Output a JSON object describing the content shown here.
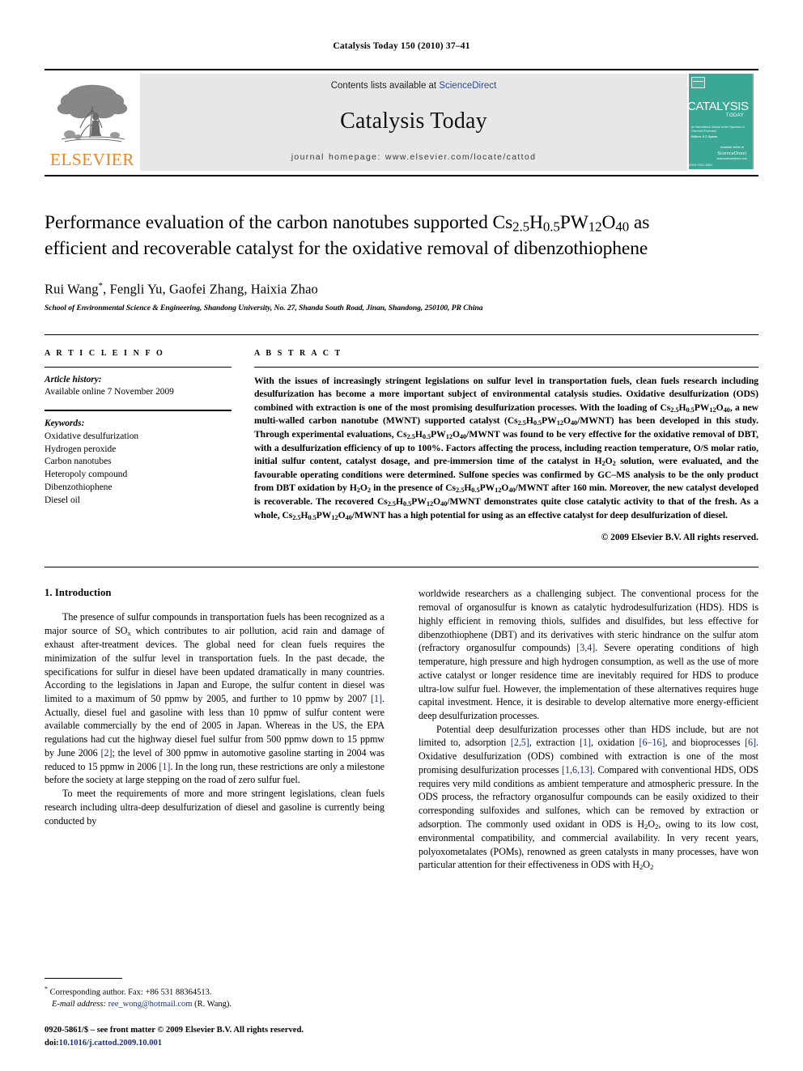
{
  "running_head": "Catalysis Today 150 (2010) 37–41",
  "masthead": {
    "publisher_name": "ELSEVIER",
    "contents_prefix": "Contents lists available at ",
    "contents_link": "ScienceDirect",
    "journal_name": "Catalysis Today",
    "homepage": "journal homepage: www.elsevier.com/locate/cattod",
    "cover": {
      "title": "CATALYSIS",
      "year": "TODAY",
      "subtitle": "An International Journal on the Dynamics of Chemical Processes",
      "editors": "Editors:\nS.T. Oyama",
      "sd_label": "Available online at",
      "sd_name": "ScienceDirect",
      "sd_url": "www.sciencedirect.com",
      "footer": "ISSN 0920-5861"
    }
  },
  "article": {
    "title_line1": "Performance evaluation of the carbon nanotubes supported Cs",
    "title_sub1": "2.5",
    "title_mid1": "H",
    "title_sub2": "0.5",
    "title_mid2": "PW",
    "title_sub3": "12",
    "title_mid3": "O",
    "title_sub4": "40",
    "title_tail1": " as",
    "title_line2": "efficient and recoverable catalyst for the oxidative removal of dibenzothiophene",
    "authors": "Rui Wang",
    "authors_rest": ", Fengli Yu, Gaofei Zhang, Haixia Zhao",
    "corresponding_marker": "*",
    "affiliation": "School of Environmental Science & Engineering, Shandong University, No. 27, Shanda South Road, Jinan, Shandong, 250100, PR China"
  },
  "article_info": {
    "heading": "A R T I C L E   I N F O",
    "history_label": "Article history:",
    "history_value": "Available online 7 November 2009",
    "keywords_label": "Keywords:",
    "keywords": [
      "Oxidative desulfurization",
      "Hydrogen peroxide",
      "Carbon nanotubes",
      "Heteropoly compound",
      "Dibenzothiophene",
      "Diesel oil"
    ]
  },
  "abstract": {
    "heading": "A B S T R A C T",
    "text_part1": "With the issues of increasingly stringent legislations on sulfur level in transportation fuels, clean fuels research including desulfurization has become a more important subject of environmental catalysis studies. Oxidative desulfurization (ODS) combined with extraction is one of the most promising desulfurization processes. With the loading of ",
    "text_part2": ", a new multi-walled carbon nanotube (MWNT) supported catalyst (",
    "text_part3": "/MWNT) has been developed in this study. Through experimental evaluations, ",
    "text_part4": "/MWNT was found to be very effective for the oxidative removal of DBT, with a desulfurization efficiency of up to 100%. Factors affecting the process, including reaction temperature, O/S molar ratio, initial sulfur content, catalyst dosage, and pre-immersion time of the catalyst in H",
    "text_part5": " solution, were evaluated, and the favourable operating conditions were determined. Sulfone species was confirmed by GC–MS analysis to be the only product from DBT oxidation by H",
    "text_part6": " in the presence of ",
    "text_part7": "/MWNT after 160 min. Moreover, the new catalyst developed is recoverable. The recovered ",
    "text_part8": "/MWNT demonstrates quite close catalytic activity to that of the fresh. As a whole, ",
    "text_part9": "/MWNT has a high potential for using as an effective catalyst for deep desulfurization of diesel.",
    "copyright": "© 2009 Elsevier B.V. All rights reserved."
  },
  "introduction": {
    "heading": "1. Introduction",
    "left_p1_a": "The presence of sulfur compounds in transportation fuels has been recognized as a major source of SO",
    "left_p1_sub": "x",
    "left_p1_b": " which contributes to air pollution, acid rain and damage of exhaust after-treatment devices. The global need for clean fuels requires the minimization of the sulfur level in transportation fuels. In the past decade, the specifications for sulfur in diesel have been updated dramatically in many countries. According to the legislations in Japan and Europe, the sulfur content in diesel was limited to a maximum of 50 ppmw by 2005, and further to 10 ppmw by 2007 ",
    "cite1": "[1]",
    "left_p1_c": ". Actually, diesel fuel and gasoline with less than 10 ppmw of sulfur content were available commercially by the end of 2005 in Japan. Whereas in the US, the EPA regulations had cut the highway diesel fuel sulfur from 500 ppmw down to 15 ppmw by June 2006 ",
    "cite2": "[2]",
    "left_p1_d": "; the level of 300 ppmw in automotive gasoline starting in 2004 was reduced to 15 ppmw in 2006 ",
    "cite3": "[1]",
    "left_p1_e": ". In the long run, these restrictions are only a milestone before the society at large stepping on the road of zero sulfur fuel.",
    "left_p2": "To meet the requirements of more and more stringent legislations, clean fuels research including ultra-deep desulfurization of diesel and gasoline is currently being conducted by",
    "right_p1_a": "worldwide researchers as a challenging subject. The conventional process for the removal of organosulfur is known as catalytic hydrodesulfurization (HDS). HDS is highly efficient in removing thiols, sulfides and disulfides, but less effective for dibenzothiophene (DBT) and its derivatives with steric hindrance on the sulfur atom (refractory organosulfur compounds) ",
    "cite4": "[3,4]",
    "right_p1_b": ". Severe operating conditions of high temperature, high pressure and high hydrogen consumption, as well as the use of more active catalyst or longer residence time are inevitably required for HDS to produce ultra-low sulfur fuel. However, the implementation of these alternatives requires huge capital investment. Hence, it is desirable to develop alternative more energy-efficient deep desulfurization processes.",
    "right_p2_a": "Potential deep desulfurization processes other than HDS include, but are not limited to, adsorption ",
    "cite5": "[2,5]",
    "right_p2_b": ", extraction ",
    "cite6": "[1]",
    "right_p2_c": ", oxidation ",
    "cite7": "[6–16]",
    "right_p2_d": ", and bioprocesses ",
    "cite8": "[6]",
    "right_p2_e": ". Oxidative desulfurization (ODS) combined with extraction is one of the most promising desulfurization processes ",
    "cite9": "[1,6,13]",
    "right_p2_f": ". Compared with conventional HDS, ODS requires very mild conditions as ambient temperature and atmospheric pressure. In the ODS process, the refractory organosulfur compounds can be easily oxidized to their corresponding sulfoxides and sulfones, which can be removed by extraction or adsorption. The commonly used oxidant in ODS is H",
    "right_p2_g": ", owing to its low cost, environmental compatibility, and commercial availability. In very recent years, polyoxometalates (POMs), renowned as green catalysts in many processes, have won particular attention for their effectiveness in ODS with H",
    "right_p2_h": ""
  },
  "footnotes": {
    "corresponding_marker": "*",
    "corresponding_text": "Corresponding author. Fax: +86 531 88364513.",
    "email_label": "E-mail address:",
    "email": "ree_wong@hotmail.com",
    "email_owner": "(R. Wang)."
  },
  "imprint": {
    "line1": "0920-5861/$ – see front matter © 2009 Elsevier B.V. All rights reserved.",
    "doi_prefix": "doi:",
    "doi_value": "10.1016/j.cattod.2009.10.001"
  },
  "colors": {
    "link_blue": "#2b4ba0",
    "citation_blue": "#1d2f7a",
    "elsevier_orange": "#F08521",
    "masthead_grey": "#e7e7e7",
    "cover_teal": "#3aa894"
  }
}
